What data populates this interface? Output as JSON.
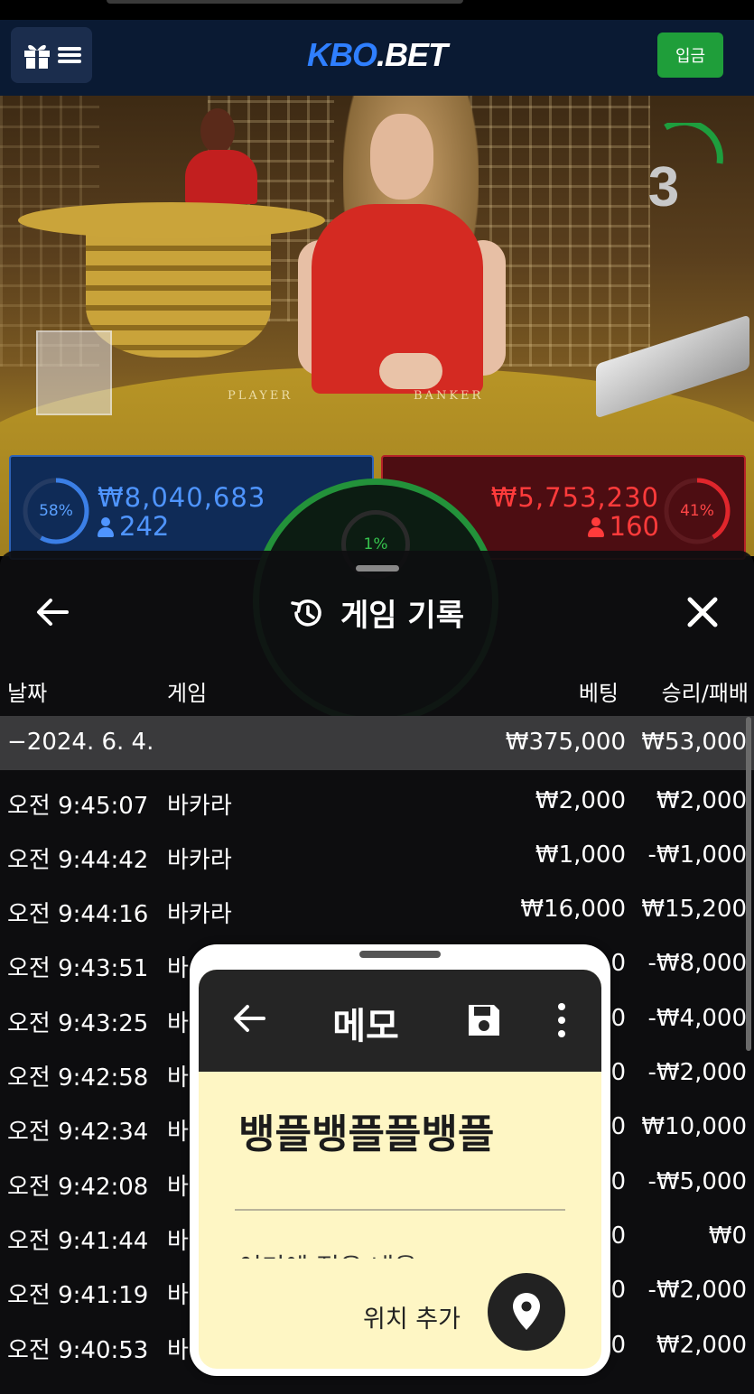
{
  "header": {
    "logo_part1": "KBO",
    "logo_part2": ".BET",
    "deposit_label": "입금"
  },
  "game": {
    "countdown": "3",
    "felt_player": "PLAYER",
    "felt_banker": "BANKER",
    "player": {
      "percent": "58%",
      "amount": "₩8,040,683",
      "bettors": "242",
      "color": "#2e63b7"
    },
    "banker": {
      "percent": "41%",
      "amount": "₩5,753,230",
      "bettors": "160",
      "color": "#b52328"
    },
    "tie": {
      "percent": "1%",
      "color": "#23923a"
    }
  },
  "history": {
    "title": "게임 기록",
    "columns": {
      "date": "날짜",
      "game": "게임",
      "bet": "베팅",
      "result": "승리/패배"
    },
    "date_group": {
      "date": "−2024. 6. 4.",
      "bet": "₩375,000",
      "result": "₩53,000"
    },
    "rows": [
      {
        "time": "오전 9:45:07",
        "game": "바카라",
        "bet": "₩2,000",
        "result": "₩2,000"
      },
      {
        "time": "오전 9:44:42",
        "game": "바카라",
        "bet": "₩1,000",
        "result": "-₩1,000"
      },
      {
        "time": "오전 9:44:16",
        "game": "바카라",
        "bet": "₩16,000",
        "result": "₩15,200"
      },
      {
        "time": "오전 9:43:51",
        "game": "바",
        "bet": "0",
        "result": "-₩8,000"
      },
      {
        "time": "오전 9:43:25",
        "game": "바",
        "bet": "0",
        "result": "-₩4,000"
      },
      {
        "time": "오전 9:42:58",
        "game": "바",
        "bet": "0",
        "result": "-₩2,000"
      },
      {
        "time": "오전 9:42:34",
        "game": "바",
        "bet": "0",
        "result": "₩10,000"
      },
      {
        "time": "오전 9:42:08",
        "game": "바",
        "bet": "0",
        "result": "-₩5,000"
      },
      {
        "time": "오전 9:41:44",
        "game": "바",
        "bet": "0",
        "result": "₩0"
      },
      {
        "time": "오전 9:41:19",
        "game": "바",
        "bet": "0",
        "result": "-₩2,000"
      },
      {
        "time": "오전 9:40:53",
        "game": "바",
        "bet": "0",
        "result": "₩2,000"
      }
    ]
  },
  "memo": {
    "title": "메모",
    "heading": "뱅플뱅플플뱅플",
    "body": "여기에 적은 내용",
    "location_label": "위치 추가"
  }
}
